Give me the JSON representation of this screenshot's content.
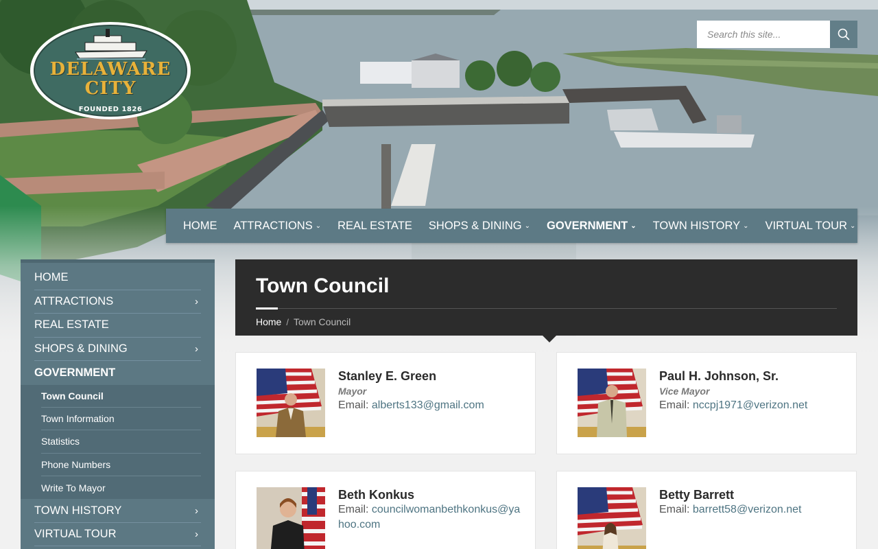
{
  "site": {
    "logo_text_line1": "DELAWARE",
    "logo_text_line2": "CITY",
    "logo_tagline": "FOUNDED 1826"
  },
  "search": {
    "placeholder": "Search this site...",
    "icon": "search-icon"
  },
  "topnav": [
    {
      "label": "HOME",
      "has_dropdown": false
    },
    {
      "label": "ATTRACTIONS",
      "has_dropdown": true
    },
    {
      "label": "REAL ESTATE",
      "has_dropdown": false
    },
    {
      "label": "SHOPS & DINING",
      "has_dropdown": true
    },
    {
      "label": "GOVERNMENT",
      "has_dropdown": true,
      "active": true
    },
    {
      "label": "TOWN HISTORY",
      "has_dropdown": true
    },
    {
      "label": "VIRTUAL TOUR",
      "has_dropdown": true
    }
  ],
  "sidebar": {
    "items": [
      {
        "label": "HOME"
      },
      {
        "label": "ATTRACTIONS",
        "arrow": "›"
      },
      {
        "label": "REAL ESTATE"
      },
      {
        "label": "SHOPS & DINING",
        "arrow": "›"
      },
      {
        "label": "GOVERNMENT"
      },
      {
        "label": "TOWN HISTORY",
        "arrow": "›"
      },
      {
        "label": "VIRTUAL TOUR",
        "arrow": "›"
      }
    ],
    "submenu": [
      {
        "label": "Town Council"
      },
      {
        "label": "Town Information"
      },
      {
        "label": "Statistics"
      },
      {
        "label": "Phone Numbers"
      },
      {
        "label": "Write To Mayor"
      }
    ]
  },
  "page": {
    "title": "Town Council",
    "breadcrumb_home": "Home",
    "breadcrumb_sep": "/",
    "breadcrumb_current": "Town Council"
  },
  "council": [
    {
      "name": "Stanley E. Green",
      "role": "Mayor",
      "email_label": "Email:",
      "email": "alberts133@gmail.com"
    },
    {
      "name": "Paul H. Johnson, Sr.",
      "role": "Vice Mayor",
      "email_label": "Email:",
      "email": "nccpj1971@verizon.net"
    },
    {
      "name": "Beth Konkus",
      "role": "",
      "email_label": "Email:",
      "email": "councilwomanbethkonkus@yahoo.com"
    },
    {
      "name": "Betty Barrett",
      "role": "",
      "email_label": "Email:",
      "email": "barrett58@verizon.net"
    }
  ],
  "colors": {
    "nav_bg": "#5d7a85",
    "sidebar_bg": "#5c7883",
    "banner_bg": "#2c2c2c",
    "link": "#4e7482",
    "logo_green": "#3f6b62",
    "logo_gold": "#e8b23a"
  }
}
